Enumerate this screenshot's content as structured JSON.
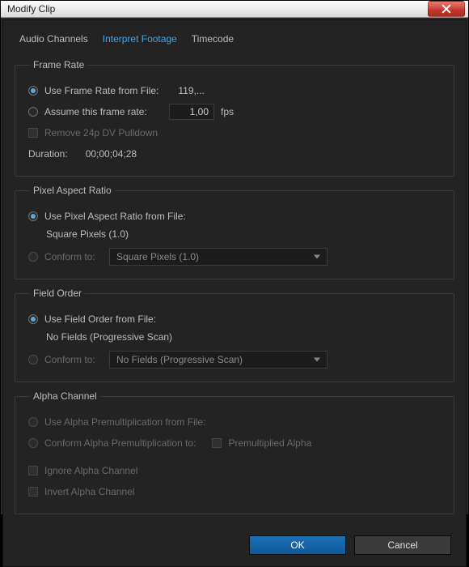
{
  "window": {
    "title": "Modify Clip"
  },
  "tabs": {
    "audio": "Audio Channels",
    "interpret": "Interpret Footage",
    "timecode": "Timecode"
  },
  "frameRate": {
    "legend": "Frame Rate",
    "useFromFile": "Use Frame Rate from File:",
    "fileFps": "119,...",
    "assume": "Assume this frame rate:",
    "assumeValue": "1,00",
    "fpsUnit": "fps",
    "removePulldown": "Remove 24p DV Pulldown",
    "durationLabel": "Duration:",
    "durationValue": "00;00;04;28"
  },
  "par": {
    "legend": "Pixel Aspect Ratio",
    "useFromFile": "Use Pixel Aspect Ratio from File:",
    "fileValue": "Square Pixels (1.0)",
    "conform": "Conform to:",
    "conformValue": "Square Pixels (1.0)"
  },
  "fieldOrder": {
    "legend": "Field Order",
    "useFromFile": "Use Field Order from File:",
    "fileValue": "No Fields (Progressive Scan)",
    "conform": "Conform to:",
    "conformValue": "No Fields (Progressive Scan)"
  },
  "alpha": {
    "legend": "Alpha Channel",
    "useFromFile": "Use Alpha Premultiplication from File:",
    "conform": "Conform Alpha Premultiplication to:",
    "premult": "Premultiplied Alpha",
    "ignore": "Ignore Alpha Channel",
    "invert": "Invert Alpha Channel"
  },
  "buttons": {
    "ok": "OK",
    "cancel": "Cancel"
  }
}
